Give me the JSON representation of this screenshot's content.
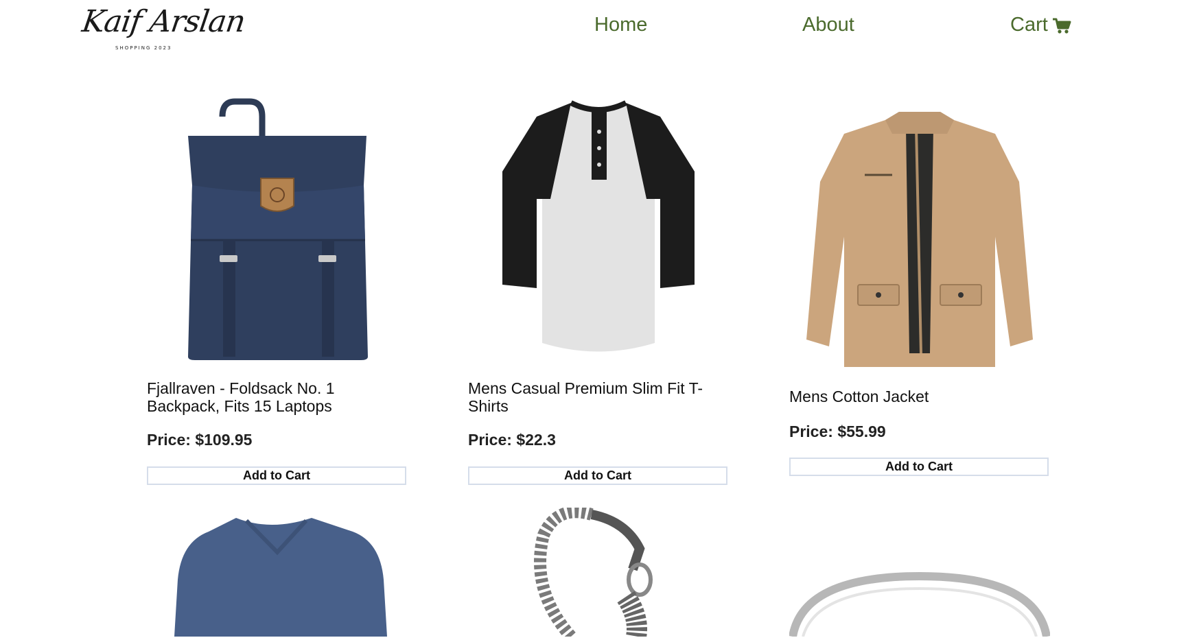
{
  "brand": {
    "name": "Kaif Arslan",
    "tagline": "SHOPPING 2023"
  },
  "nav": {
    "home": "Home",
    "about": "About",
    "cart": "Cart",
    "cart_icon": "shopping-cart-icon"
  },
  "colors": {
    "nav_link": "#4a6a2c",
    "button_border": "#d5ddea",
    "background": "#ffffff"
  },
  "products": [
    {
      "title": "Fjallraven - Foldsack No. 1 Backpack, Fits 15 Laptops",
      "price": "Price: $109.95",
      "button": "Add to Cart",
      "image": "navy-backpack"
    },
    {
      "title": "Mens Casual Premium Slim Fit T-Shirts",
      "price": "Price: $22.3",
      "button": "Add to Cart",
      "image": "raglan-henley-tshirt"
    },
    {
      "title": "Mens Cotton Jacket",
      "price": "Price: $55.99",
      "button": "Add to Cart",
      "image": "khaki-cotton-jacket"
    },
    {
      "image": "blue-vneck-longsleeve"
    },
    {
      "image": "silver-dragon-bracelet"
    },
    {
      "image": "silver-ring"
    }
  ]
}
